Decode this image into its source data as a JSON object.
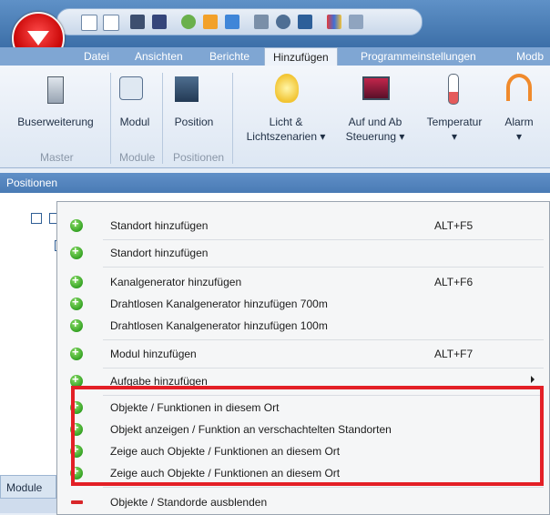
{
  "app": {
    "menu_tabs": [
      "Datei",
      "Ansichten",
      "Berichte",
      "Hinzufügen",
      "Programmeinstellungen",
      "Modb"
    ],
    "active_tab": "Hinzufügen"
  },
  "ribbon": {
    "buttons": [
      {
        "label": "Buserweiterung",
        "icon": "bus-extension-icon"
      },
      {
        "label": "Modul",
        "icon": "module-icon"
      },
      {
        "label": "Position",
        "icon": "building-icon"
      },
      {
        "label": "Licht &",
        "label2": "Lichtszenarien ▾",
        "icon": "light-bulb-icon"
      },
      {
        "label": "Auf und Ab",
        "label2": "Steuerung ▾",
        "icon": "shutter-icon"
      },
      {
        "label": "Temperatur",
        "label2": "▾",
        "icon": "thermometer-icon"
      },
      {
        "label": "Alarm",
        "label2": "▾",
        "icon": "alarm-icon"
      }
    ],
    "groups": [
      "Master",
      "Module",
      "Positionen"
    ]
  },
  "positions_panel": {
    "title": "Positionen"
  },
  "module_panel": {
    "title": "Module"
  },
  "context_menu": {
    "items": [
      {
        "label": "Standort hinzufügen",
        "shortcut": "ALT+F5"
      },
      {
        "label": "Standort hinzufügen",
        "shortcut": ""
      },
      {
        "label": "Kanalgenerator hinzufügen",
        "shortcut": "ALT+F6"
      },
      {
        "label": "Drahtlosen Kanalgenerator hinzufügen 700m",
        "shortcut": ""
      },
      {
        "label": "Drahtlosen Kanalgenerator hinzufügen 100m",
        "shortcut": ""
      },
      {
        "label": "Modul hinzufügen",
        "shortcut": "ALT+F7"
      },
      {
        "label": "Aufgabe hinzufügen",
        "shortcut": ""
      },
      {
        "label": "Objekte / Funktionen in diesem Ort",
        "shortcut": ""
      },
      {
        "label": "Objekt anzeigen / Funktion an verschachtelten Standorten",
        "shortcut": ""
      },
      {
        "label": "Zeige auch Objekte / Funktionen an diesem Ort",
        "shortcut": ""
      },
      {
        "label": "Zeige auch Objekte / Funktionen an diesem Ort",
        "shortcut": ""
      },
      {
        "label": "Objekte / Standorde ausblenden",
        "shortcut": ""
      }
    ]
  },
  "colors": {
    "highlight": "#e31f26",
    "title_bar": "#4a7bb5"
  }
}
